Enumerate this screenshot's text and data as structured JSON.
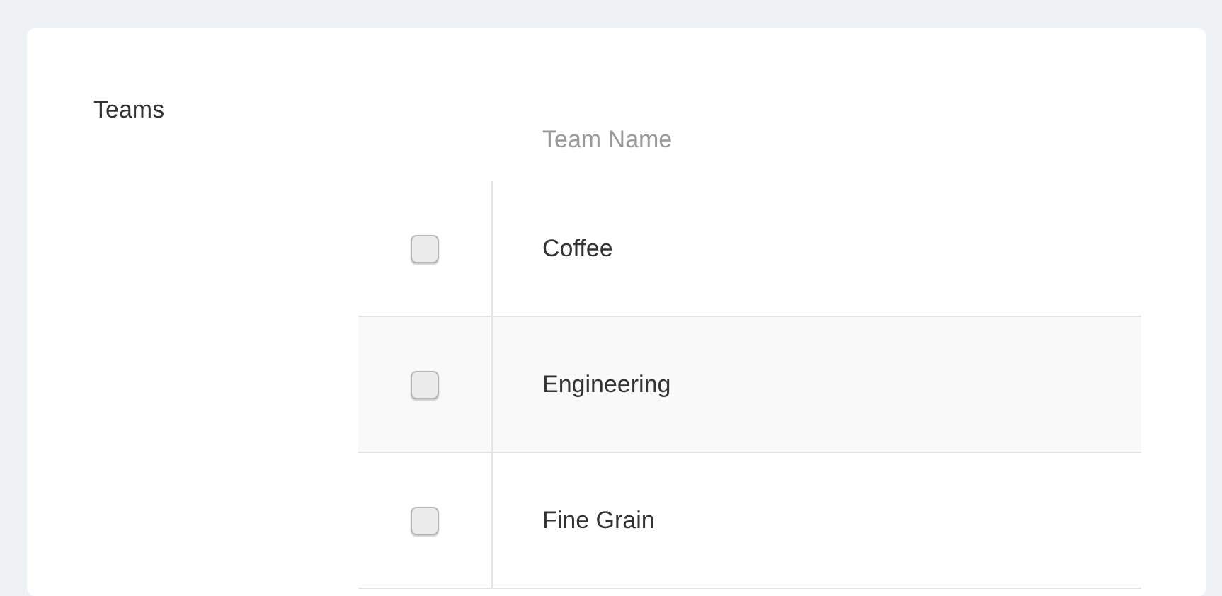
{
  "section": {
    "title": "Teams"
  },
  "table": {
    "columns": [
      "Team Name"
    ],
    "rows": [
      {
        "name": "Coffee",
        "checked": false
      },
      {
        "name": "Engineering",
        "checked": false
      },
      {
        "name": "Fine Grain",
        "checked": false
      }
    ]
  }
}
